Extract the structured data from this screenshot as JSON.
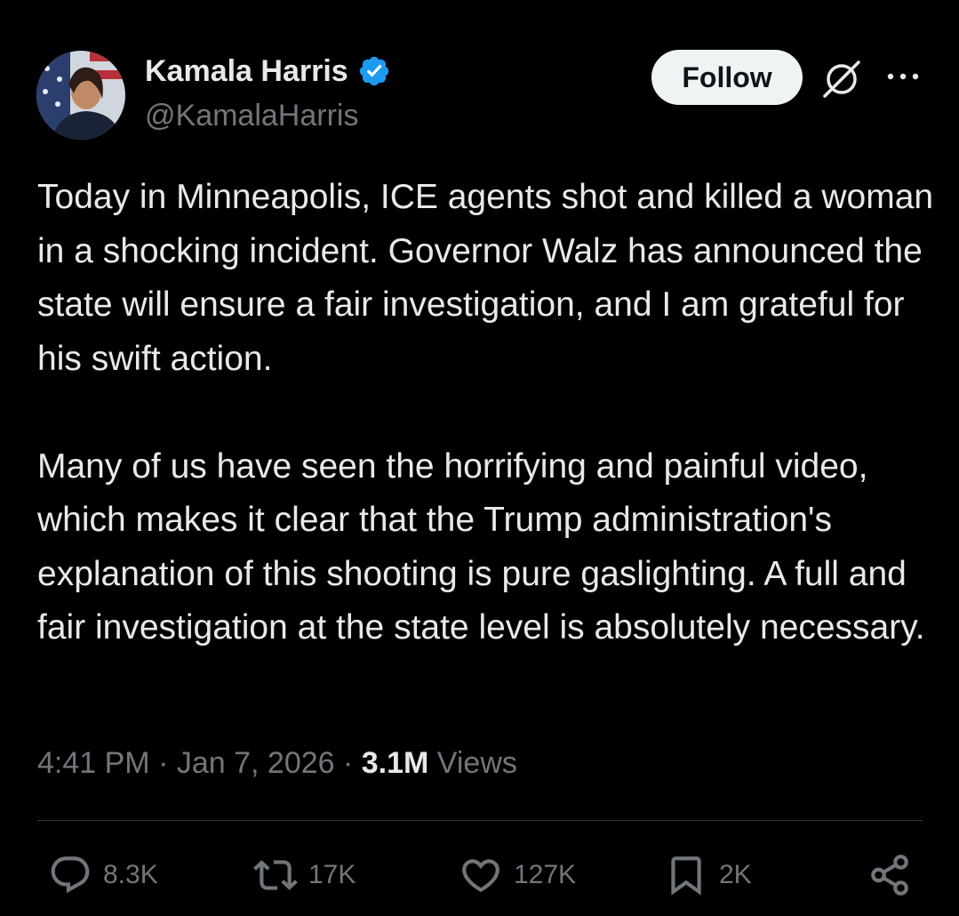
{
  "author": {
    "name": "Kamala Harris",
    "handle": "@KamalaHarris",
    "verified_color": "#1d9bf0"
  },
  "header": {
    "follow_label": "Follow",
    "grok_icon": "grok-icon",
    "more_icon": "more-horizontal-icon"
  },
  "tweet": {
    "text": "Today in Minneapolis, ICE agents shot and killed a woman in a shocking incident. Governor Walz has announced the state will ensure a fair investigation, and I am grateful for his swift action.\n\nMany of us have seen the horrifying and painful video, which makes it clear that the Trump administration's explanation of this shooting is pure gaslighting. A full and fair investigation at the state level is absolutely necessary.",
    "time": "4:41 PM",
    "sep1": " · ",
    "date": "Jan 7, 2026",
    "sep2": " · ",
    "views_count": "3.1M",
    "views_label": " Views"
  },
  "actions": {
    "replies": "8.3K",
    "reposts": "17K",
    "likes": "127K",
    "bookmarks": "2K"
  },
  "colors": {
    "background": "#000000",
    "text": "#e7e9ea",
    "secondary": "#71767b",
    "accent": "#1d9bf0"
  }
}
